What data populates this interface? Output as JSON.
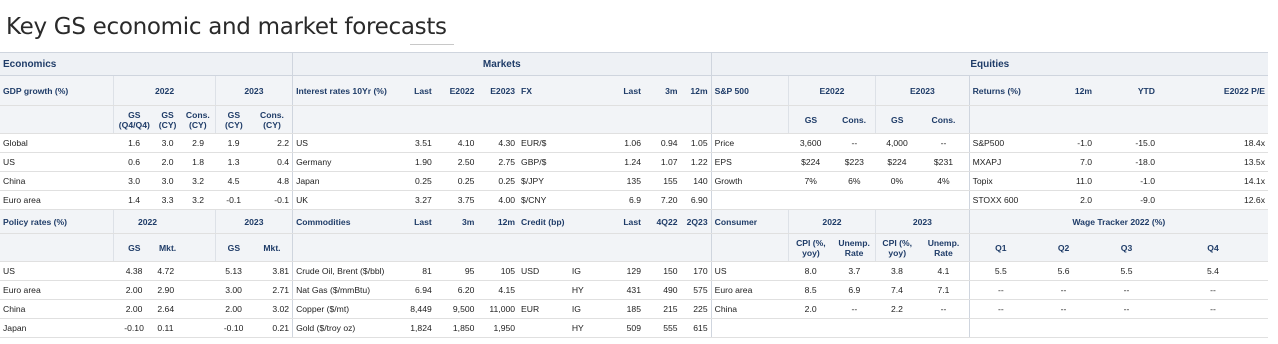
{
  "title": "Key GS economic and market forecasts",
  "sections": {
    "economics": "Economics",
    "markets": "Markets",
    "equities": "Equities"
  },
  "gdp": {
    "header": "GDP growth (%)",
    "year1": "2022",
    "year2": "2023",
    "cols": [
      "GS (Q4/Q4)",
      "GS (CY)",
      "Cons. (CY)",
      "GS (CY)",
      "Cons. (CY)"
    ],
    "rows": [
      {
        "label": "Global",
        "values": [
          "1.6",
          "3.0",
          "2.9",
          "1.9",
          "2.2"
        ]
      },
      {
        "label": "US",
        "values": [
          "0.6",
          "2.0",
          "1.8",
          "1.3",
          "0.4"
        ]
      },
      {
        "label": "China",
        "values": [
          "3.0",
          "3.0",
          "3.2",
          "4.5",
          "4.8"
        ]
      },
      {
        "label": "Euro area",
        "values": [
          "1.4",
          "3.3",
          "3.2",
          "-0.1",
          "-0.1"
        ]
      }
    ]
  },
  "rates": {
    "header": "Interest rates 10Yr (%)",
    "cols": [
      "Last",
      "E2022",
      "E2023"
    ],
    "rows": [
      {
        "label": "US",
        "values": [
          "3.51",
          "4.10",
          "4.30"
        ]
      },
      {
        "label": "Germany",
        "values": [
          "1.90",
          "2.50",
          "2.75"
        ]
      },
      {
        "label": "Japan",
        "values": [
          "0.25",
          "0.25",
          "0.25"
        ]
      },
      {
        "label": "UK",
        "values": [
          "3.27",
          "3.75",
          "4.00"
        ]
      }
    ]
  },
  "fx": {
    "header": "FX",
    "cols": [
      "Last",
      "3m",
      "12m"
    ],
    "rows": [
      {
        "label": "EUR/$",
        "values": [
          "1.06",
          "0.94",
          "1.05"
        ]
      },
      {
        "label": "GBP/$",
        "values": [
          "1.24",
          "1.07",
          "1.22"
        ]
      },
      {
        "label": "$/JPY",
        "values": [
          "135",
          "155",
          "140"
        ]
      },
      {
        "label": "$/CNY",
        "values": [
          "6.9",
          "7.20",
          "6.90"
        ]
      }
    ]
  },
  "sp500": {
    "header": "S&P 500",
    "year1": "E2022",
    "year2": "E2023",
    "cols": [
      "GS",
      "Cons.",
      "GS",
      "Cons."
    ],
    "rows": [
      {
        "label": "Price",
        "values": [
          "3,600",
          "--",
          "4,000",
          "--"
        ]
      },
      {
        "label": "EPS",
        "values": [
          "$224",
          "$223",
          "$224",
          "$231"
        ]
      },
      {
        "label": "Growth",
        "values": [
          "7%",
          "6%",
          "0%",
          "4%"
        ]
      }
    ]
  },
  "returns": {
    "header": "Returns (%)",
    "cols": [
      "12m",
      "YTD",
      "E2022 P/E"
    ],
    "rows": [
      {
        "label": "S&P500",
        "values": [
          "-1.0",
          "-15.0",
          "18.4x"
        ]
      },
      {
        "label": "MXAPJ",
        "values": [
          "7.0",
          "-18.0",
          "13.5x"
        ]
      },
      {
        "label": "Topix",
        "values": [
          "11.0",
          "-1.0",
          "14.1x"
        ]
      },
      {
        "label": "STOXX 600",
        "values": [
          "2.0",
          "-9.0",
          "12.6x"
        ]
      }
    ]
  },
  "policy": {
    "header": "Policy rates (%)",
    "year1": "2022",
    "year2": "2023",
    "cols": [
      "GS",
      "Mkt.",
      "GS",
      "Mkt."
    ],
    "rows": [
      {
        "label": "US",
        "values": [
          "4.38",
          "4.72",
          "5.13",
          "3.81"
        ]
      },
      {
        "label": "Euro area",
        "values": [
          "2.00",
          "2.90",
          "3.00",
          "2.71"
        ]
      },
      {
        "label": "China",
        "values": [
          "2.00",
          "2.64",
          "2.00",
          "3.02"
        ]
      },
      {
        "label": "Japan",
        "values": [
          "-0.10",
          "0.11",
          "-0.10",
          "0.21"
        ]
      }
    ]
  },
  "commodities": {
    "header": "Commodities",
    "cols": [
      "Last",
      "3m",
      "12m"
    ],
    "rows": [
      {
        "label": "Crude Oil, Brent ($/bbl)",
        "values": [
          "81",
          "95",
          "105"
        ]
      },
      {
        "label": "Nat Gas ($/mmBtu)",
        "values": [
          "6.94",
          "6.20",
          "4.15"
        ]
      },
      {
        "label": "Copper ($/mt)",
        "values": [
          "8,449",
          "9,500",
          "11,000"
        ]
      },
      {
        "label": "Gold ($/troy oz)",
        "values": [
          "1,824",
          "1,850",
          "1,950"
        ]
      }
    ]
  },
  "credit": {
    "header": "Credit (bp)",
    "cols": [
      "Last",
      "4Q22",
      "2Q23"
    ],
    "rows": [
      {
        "label": "USD",
        "grade": "IG",
        "values": [
          "129",
          "150",
          "170"
        ]
      },
      {
        "label": "",
        "grade": "HY",
        "values": [
          "431",
          "490",
          "575"
        ]
      },
      {
        "label": "EUR",
        "grade": "IG",
        "values": [
          "185",
          "215",
          "225"
        ]
      },
      {
        "label": "",
        "grade": "HY",
        "values": [
          "509",
          "555",
          "615"
        ]
      }
    ]
  },
  "consumer": {
    "header": "Consumer",
    "year1": "2022",
    "year2": "2023",
    "cols": [
      "CPI (%, yoy)",
      "Unemp. Rate",
      "CPI (%, yoy)",
      "Unemp. Rate"
    ],
    "rows": [
      {
        "label": "US",
        "values": [
          "8.0",
          "3.7",
          "3.8",
          "4.1"
        ]
      },
      {
        "label": "Euro area",
        "values": [
          "8.5",
          "6.9",
          "7.4",
          "7.1"
        ]
      },
      {
        "label": "China",
        "values": [
          "2.0",
          "--",
          "2.2",
          "--"
        ]
      },
      {
        "label": "",
        "values": [
          "",
          "",
          "",
          ""
        ]
      }
    ]
  },
  "wage": {
    "header": "Wage Tracker 2022 (%)",
    "cols": [
      "Q1",
      "Q2",
      "Q3",
      "Q4"
    ],
    "rows": [
      {
        "values": [
          "5.5",
          "5.6",
          "5.5",
          "5.4"
        ]
      },
      {
        "values": [
          "--",
          "--",
          "--",
          "--"
        ]
      },
      {
        "values": [
          "--",
          "--",
          "--",
          "--"
        ]
      },
      {
        "values": [
          "",
          "",
          "",
          ""
        ]
      }
    ]
  }
}
